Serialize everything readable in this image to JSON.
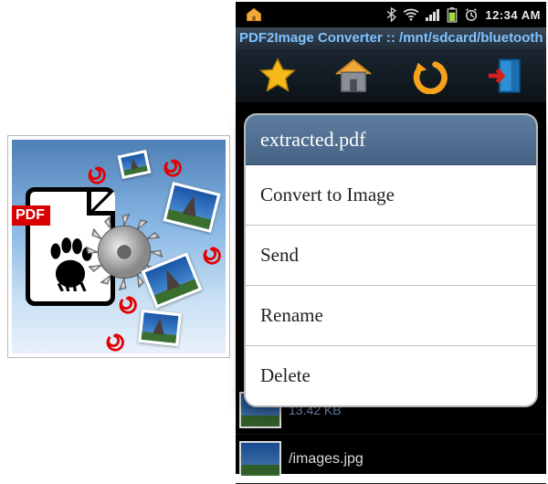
{
  "app_icon": {
    "badge": "PDF"
  },
  "status_bar": {
    "time": "12:34 AM"
  },
  "app": {
    "title": "PDF2Image Converter :: /mnt/sdcard/bluetooth"
  },
  "file_list": {
    "items": [
      {
        "name": "",
        "size": "13.42 KB"
      },
      {
        "name": "/images.jpg",
        "size": ""
      }
    ]
  },
  "dialog": {
    "title": "extracted.pdf",
    "options": [
      "Convert to Image",
      "Send",
      "Rename",
      "Delete"
    ]
  }
}
